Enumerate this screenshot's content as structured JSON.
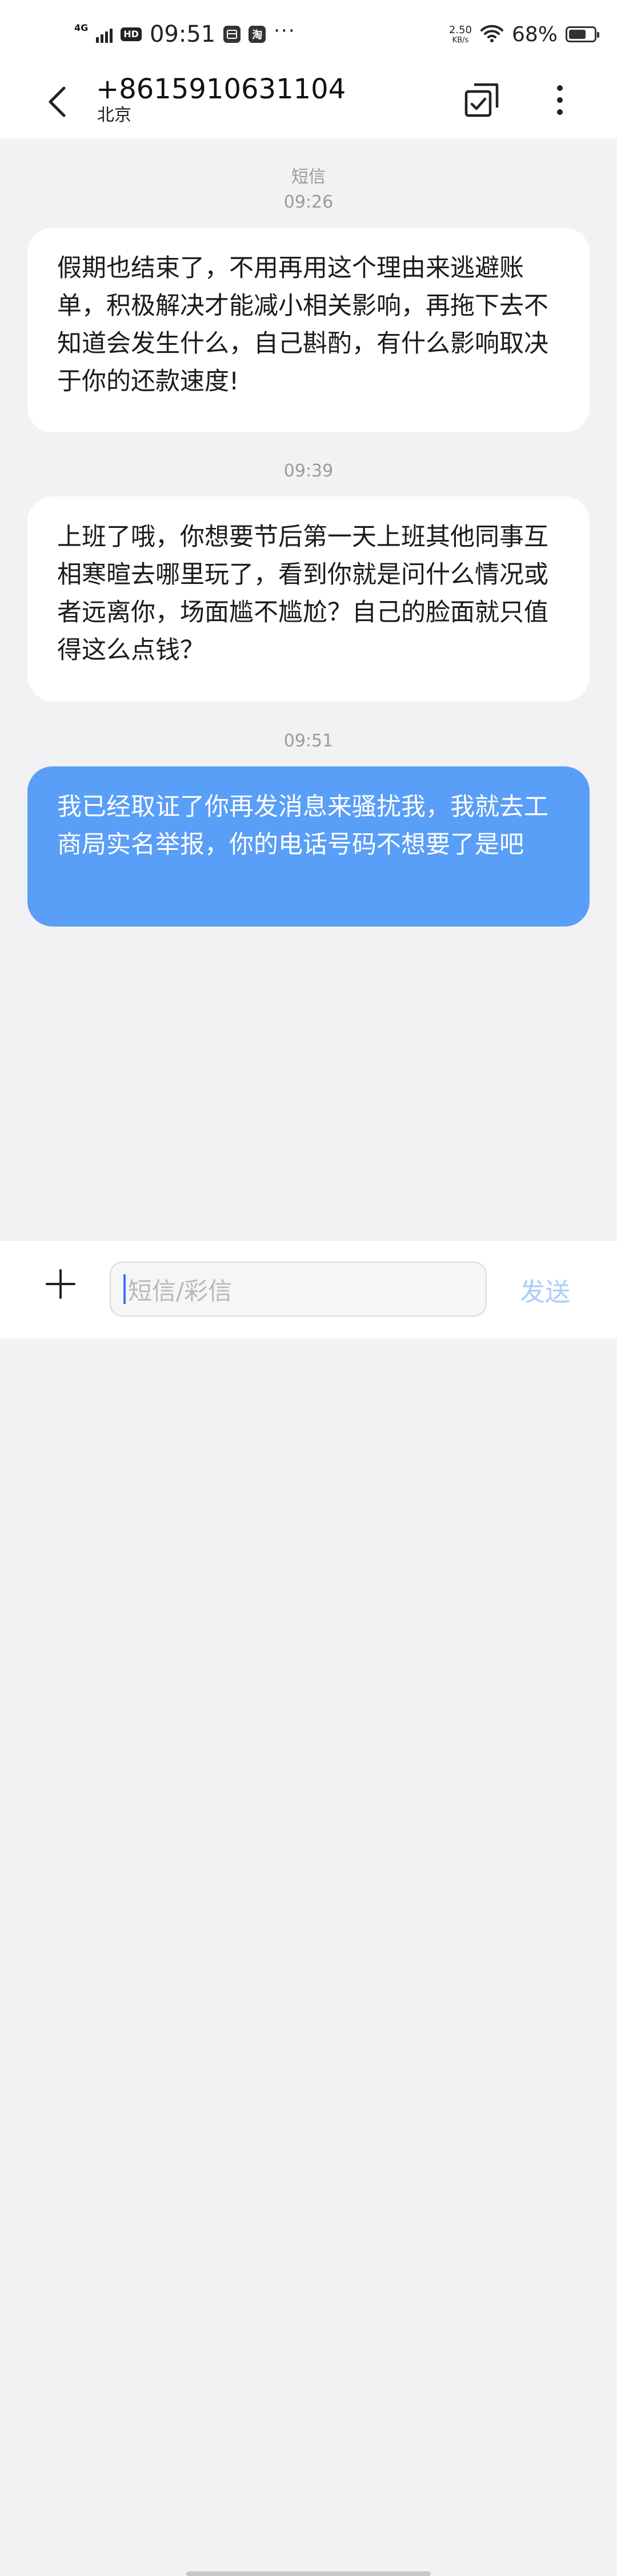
{
  "status_bar": {
    "network_type": "4G",
    "hd_label": "HD",
    "time": "09:51",
    "taobao_label": "淘",
    "more": "···",
    "net_speed_value": "2.50",
    "net_speed_unit": "KB/s",
    "battery_percent": "68%",
    "battery_level": 0.68,
    "icons": [
      "signal-icon",
      "hd-icon",
      "wallet-app-icon",
      "taobao-icon",
      "more-dots-icon",
      "wifi-icon",
      "battery-icon"
    ]
  },
  "header": {
    "contact_number": "+8615910631104",
    "location": "北京",
    "icons": [
      "back-arrow-icon",
      "multi-select-icon",
      "more-vertical-icon"
    ]
  },
  "conversation": {
    "channel_label": "短信",
    "messages": [
      {
        "time": "09:26",
        "direction": "incoming",
        "text": "假期也结束了，不用再用这个理由来逃避账单，积极解决才能减小相关影响，再拖下去不知道会发生什么，自己斟酌，有什么影响取决于你的还款速度!"
      },
      {
        "time": "09:39",
        "direction": "incoming",
        "text": "上班了哦，你想要节后第一天上班其他同事互相寒暄去哪里玩了，看到你就是问什么情况或者远离你，场面尴不尴尬？自己的脸面就只值得这么点钱？"
      },
      {
        "time": "09:51",
        "direction": "outgoing",
        "text": "我已经取证了你再发消息来骚扰我，我就去工商局实名举报，你的电话号码不想要了是吧"
      }
    ]
  },
  "composer": {
    "placeholder": "短信/彩信",
    "send_label": "发送",
    "icons": [
      "plus-icon"
    ]
  },
  "colors": {
    "background": "#f2f2f4",
    "incoming_bubble": "#ffffff",
    "outgoing_bubble": "#599ef7",
    "send_disabled": "#a9cdfa",
    "caret": "#3b73ff"
  }
}
